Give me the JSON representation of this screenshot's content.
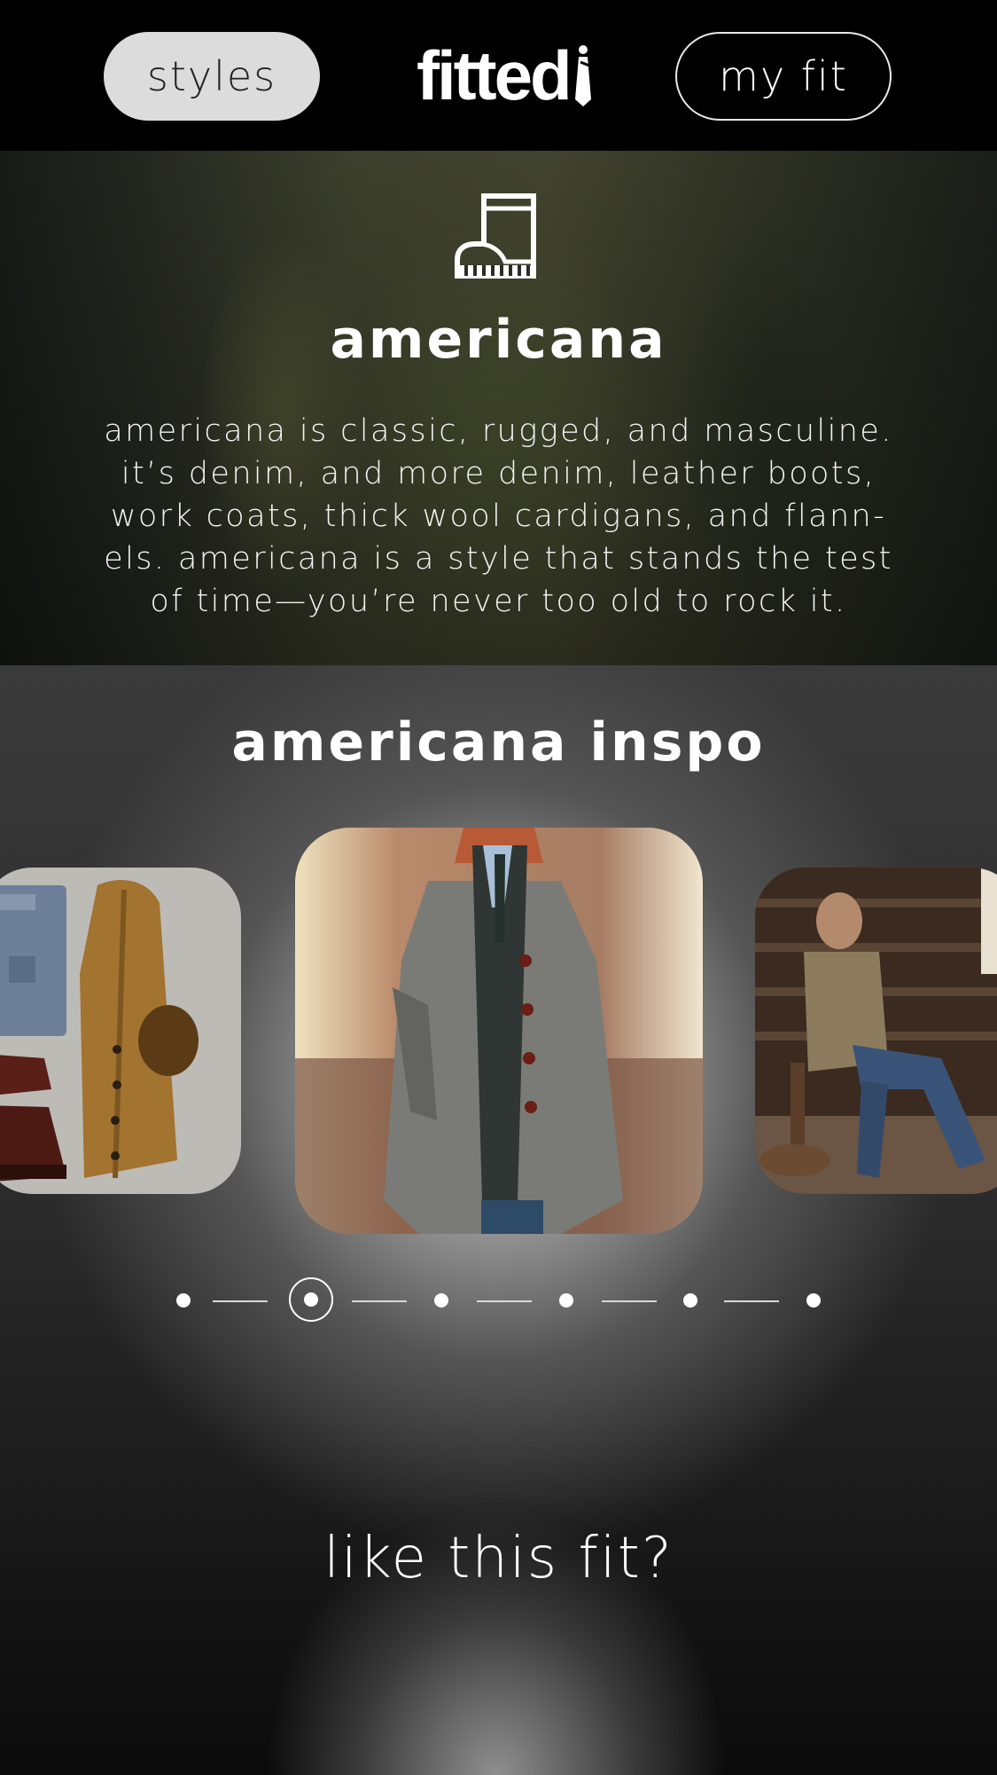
{
  "header": {
    "styles_label": "styles",
    "logo_text": "fitted",
    "my_fit_label": "my fit"
  },
  "hero": {
    "icon": "boot-icon",
    "title": "americana",
    "description": "americana is classic, rugged, and masculine. it’s denim, and more denim, leather boots, work coats, thick wool cardigans, and flann-els. americana is a style that stands the test of time—you’re never too old to rock it."
  },
  "inspo": {
    "title": "americana inspo",
    "cards": [
      "flat-lay-outfit",
      "tweed-overcoat",
      "denim-jacket-seated"
    ],
    "pager": {
      "count": 6,
      "active_index": 1
    }
  },
  "cta": {
    "label": "like this fit?"
  },
  "colors": {
    "header_bg": "#000000",
    "styles_pill_bg": "#dcdcdc",
    "text": "#ffffff"
  }
}
